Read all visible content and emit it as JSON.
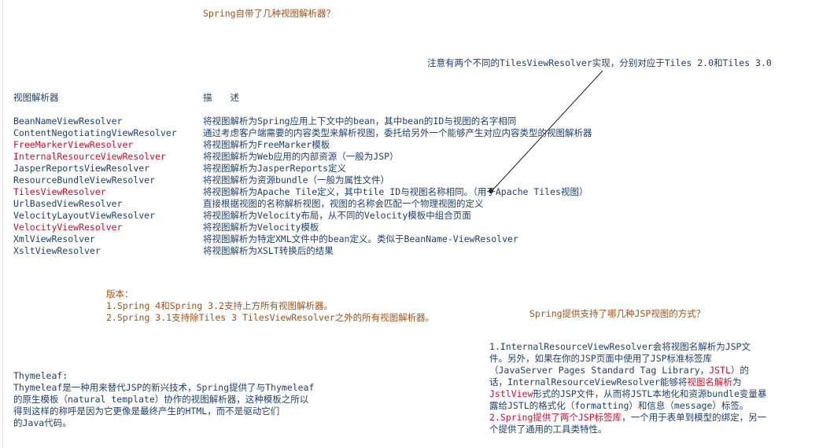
{
  "title": "Spring自带了几种视图解析器？",
  "note": "注意有两个不同的TilesViewResolver实现，分别对应于Tiles 2.0和Tiles 3.0",
  "table": {
    "header_name": "视图解析器",
    "header_desc": "描　　述",
    "rows": [
      {
        "name": "BeanNameViewResolver",
        "desc": "将视图解析为Spring应用上下文中的bean，其中bean的ID与视图的名字相同"
      },
      {
        "name": "ContentNegotiatingViewResolver",
        "desc": "通过考虑客户端需要的内容类型来解析视图，委托给另外一个能够产生对应内容类型的视图解析器"
      },
      {
        "name": "FreeMarkerViewResolver",
        "desc": "将视图解析为FreeMarker模板"
      },
      {
        "name": "InternalResourceViewResolver",
        "desc": "将视图解析为Web应用的内部资源（一般为JSP）"
      },
      {
        "name": "JasperReportsViewResolver",
        "desc": "将视图解析为JasperReports定义"
      },
      {
        "name": "ResourceBundleViewResolver",
        "desc": "将视图解析为资源bundle（一般为属性文件）"
      },
      {
        "name": "TilesViewResolver",
        "desc": "将视图解析为Apache Tile定义，其中tile ID与视图名称相同。（用于Apache Tiles视图）"
      },
      {
        "name": "UrlBasedViewResolver",
        "desc": "直接根据视图的名称解析视图，视图的名称会匹配一个物理视图的定义"
      },
      {
        "name": "VelocityLayoutViewResolver",
        "desc": "将视图解析为Velocity布局，从不同的Velocity模板中组合页面"
      },
      {
        "name": "VelocityViewResolver",
        "desc": "将视图解析为Velocity模板"
      },
      {
        "name": "XmlViewResolver",
        "desc": "将视图解析为特定XML文件中的bean定义。类似于BeanName-ViewResolver"
      },
      {
        "name": "XsltViewResolver",
        "desc": "将视图解析为XSLT转换后的结果"
      }
    ],
    "highlighted": [
      "FreeMarkerViewResolver",
      "InternalResourceViewResolver",
      "TilesViewResolver",
      "VelocityViewResolver"
    ]
  },
  "version": {
    "label": "版本：",
    "line1": "1.Spring 4和Spring 3.2支持上方所有视图解析器。",
    "line2": "2.Spring 3.1支持除Tiles 3 TilesViewResolver之外的所有视图解析器。"
  },
  "jsp_question": "Spring提供支持了哪几种JSP视图的方式？",
  "thymeleaf": {
    "label": "Thymeleaf:",
    "lines": [
      "Thymeleaf是一种用来替代JSP的新兴技术，Spring提供了与Thymeleaf",
      "的原生模板（natural template）协作的视图解析器，这种模板之所以",
      "得到这样的称呼是因为它更像是最终产生的HTML，而不是驱动它们",
      "的Java代码。"
    ]
  },
  "jsp_answer": {
    "l1": "1.InternalResourceViewResolver会将视图名解析为JSP文",
    "l2": "件。另外，如果在你的JSP页面中使用了JSP标准标签库",
    "l3a": "（JavaServer Pages Standard Tag Library，",
    "l3b": "JSTL",
    "l3c": "）的",
    "l4a": "话，InternalResourceViewResolver能够将",
    "l4b": "视图名解析",
    "l4c": "为",
    "l5a": "JstlView",
    "l5b": "形式的JSP文件，从而将JSTL本地化和资源bundle变量暴",
    "l6": "露给JSTL的格式化（formatting）和信息（message）标签。",
    "l7a": "2.Spring提供了两个JSP标签库",
    "l7b": "，一个用于表单到模型的绑定，另一",
    "l8": "个提供了通用的工具类特性。"
  },
  "colors": {
    "orange": "#a0521a",
    "navy": "#1f3f6e",
    "red": "#c8102e"
  }
}
